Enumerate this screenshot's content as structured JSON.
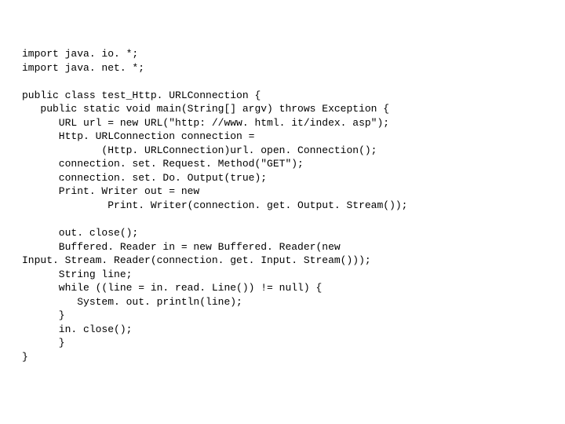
{
  "code": {
    "l01": "import java. io. *;",
    "l02": "import java. net. *;",
    "l03": "",
    "l04": "public class test_Http. URLConnection {",
    "l05": "   public static void main(String[] argv) throws Exception {",
    "l06": "      URL url = new URL(\"http: //www. html. it/index. asp\");",
    "l07": "      Http. URLConnection connection =",
    "l08": "             (Http. URLConnection)url. open. Connection();",
    "l09": "      connection. set. Request. Method(\"GET\");",
    "l10": "      connection. set. Do. Output(true);",
    "l11": "      Print. Writer out = new",
    "l12": "              Print. Writer(connection. get. Output. Stream());",
    "l13": "",
    "l14": "      out. close();",
    "l15": "      Buffered. Reader in = new Buffered. Reader(new",
    "l16": "Input. Stream. Reader(connection. get. Input. Stream()));",
    "l17": "      String line;",
    "l18": "      while ((line = in. read. Line()) != null) {",
    "l19": "         System. out. println(line);",
    "l20": "      }",
    "l21": "      in. close();",
    "l22": "      }",
    "l23": "}"
  }
}
